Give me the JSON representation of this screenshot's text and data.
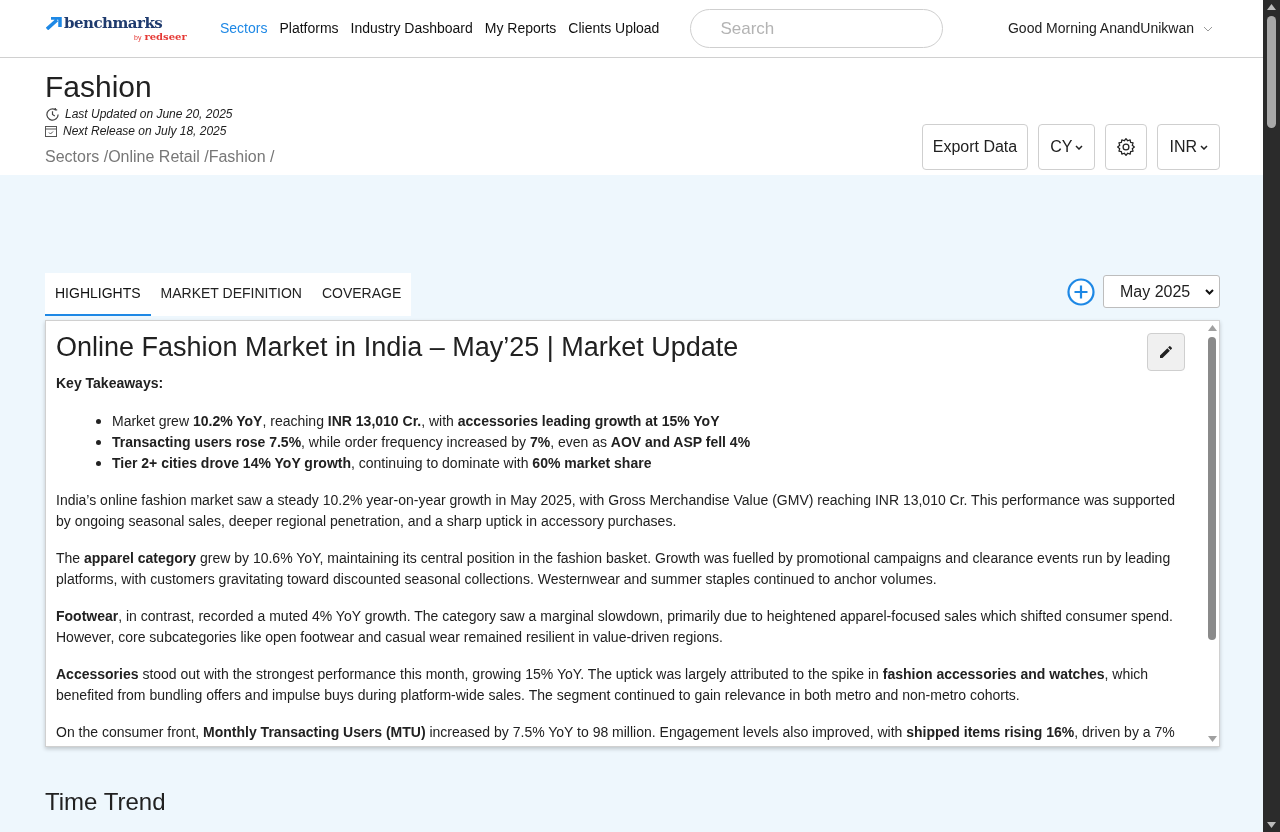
{
  "logo": {
    "name": "benchmarks",
    "by": "by",
    "brand": "redseer"
  },
  "nav": [
    {
      "label": "Sectors",
      "selected": true
    },
    {
      "label": "Platforms",
      "selected": false
    },
    {
      "label": "Industry Dashboard",
      "selected": false
    },
    {
      "label": "My Reports",
      "selected": false
    },
    {
      "label": "Clients Upload",
      "selected": false
    }
  ],
  "search": {
    "placeholder": "Search"
  },
  "user": {
    "greeting": "Good Morning AnandUnikwan"
  },
  "page": {
    "title": "Fashion",
    "last_updated": "*Last Updated on* June 20, 2025",
    "next_release": "*Next Release on* July 18, 2025",
    "breadcrumb": "Sectors /Online Retail /Fashion /"
  },
  "toolbar": {
    "export": "Export Data",
    "calendar": "CY",
    "currency": "INR"
  },
  "tabs": [
    {
      "label": "HIGHLIGHTS",
      "selected": true
    },
    {
      "label": "MARKET DEFINITION",
      "selected": false
    },
    {
      "label": "COVERAGE",
      "selected": false
    }
  ],
  "month_select": {
    "value": "May 2025"
  },
  "article": {
    "title": "Online Fashion Market in India – May’25 | Market Update",
    "subtitle": "Key Takeaways:",
    "bullets": [
      "Market grew **10.2% YoY**, reaching **INR 13,010 Cr.**, with **accessories leading growth at 15% YoY**",
      "**Transacting users rose 7.5%**, while order frequency increased by **7%**, even as **AOV and ASP fell 4%**",
      "**Tier 2+ cities drove 14% YoY growth**, continuing to dominate with **60% market share**"
    ],
    "paragraphs": [
      "India’s online fashion market saw a steady 10.2% year-on-year growth in May 2025, with Gross Merchandise Value (GMV) reaching INR 13,010 Cr. This performance was supported by ongoing seasonal sales, deeper regional penetration, and a sharp uptick in accessory purchases.",
      "The **apparel category** grew by 10.6% YoY, maintaining its central position in the fashion basket. Growth was fuelled by promotional campaigns and clearance events run by leading platforms, with customers gravitating toward discounted seasonal collections. Westernwear and summer staples continued to anchor volumes.",
      "**Footwear**, in contrast, recorded a muted 4% YoY growth. The category saw a marginal slowdown, primarily due to heightened apparel-focused sales which shifted consumer spend. However, core subcategories like open footwear and casual wear remained resilient in value-driven regions.",
      "**Accessories** stood out with the strongest performance this month, growing 15% YoY. The uptick was largely attributed to the spike in **fashion accessories and watches**, which benefited from bundling offers and impulse buys during platform-wide sales. The segment continued to gain relevance in both metro and non-metro cohorts.",
      "On the consumer front, **Monthly Transacting Users (MTU)** increased by 7.5% YoY to 98 million. Engagement levels also improved, with **shipped items rising 16%**, driven by a 7%"
    ]
  },
  "section": {
    "title": "Time Trend"
  }
}
